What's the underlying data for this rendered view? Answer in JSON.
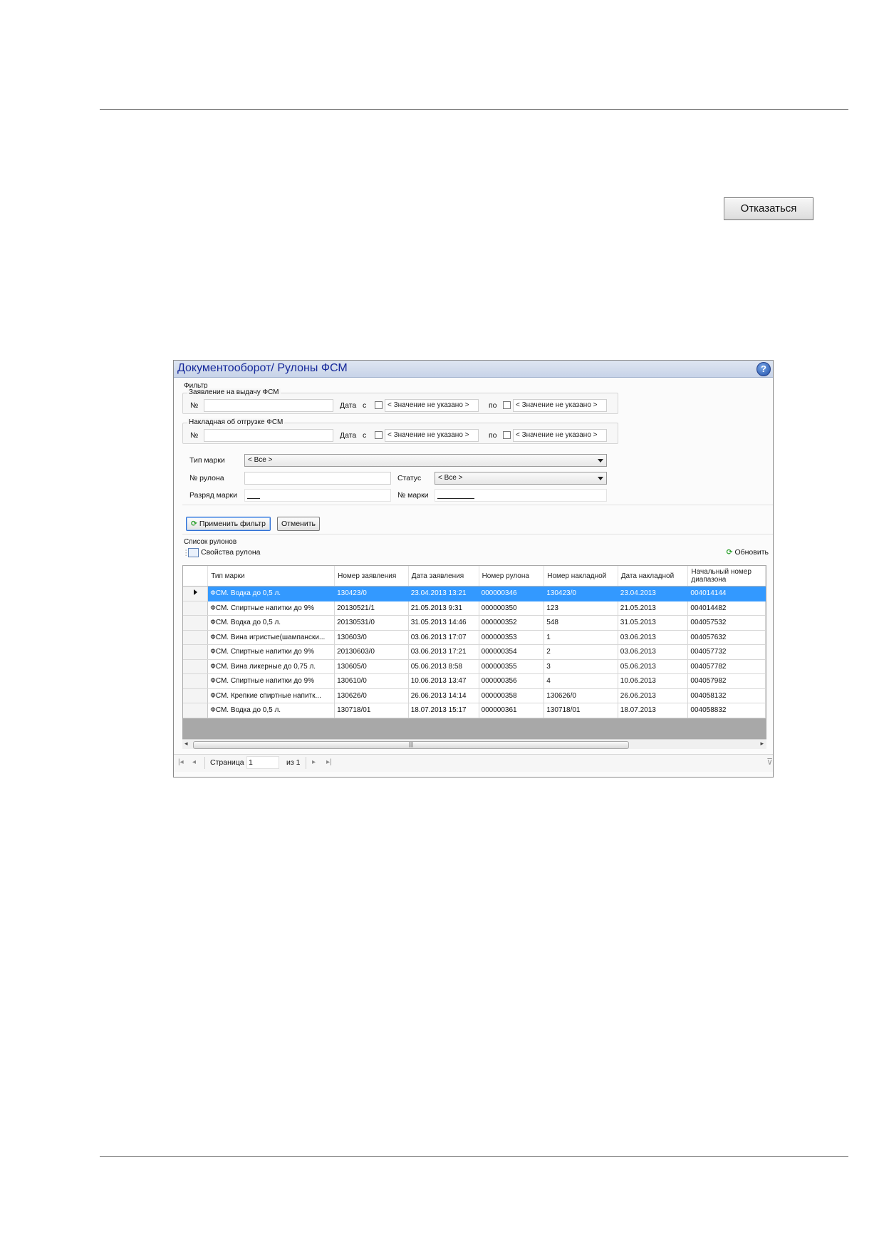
{
  "page": {
    "cancel_button": "Отказаться"
  },
  "window": {
    "title": "Документооборот/ Рулоны ФСМ",
    "help_icon": "?"
  },
  "filter": {
    "section_label": "Фильтр",
    "statement": {
      "group_label": "Заявление на выдачу ФСМ",
      "number_label": "№",
      "date_label": "Дата",
      "from_label": "с",
      "from_value": "< Значение не указано >",
      "to_label": "по",
      "to_value": "< Значение не указано >"
    },
    "invoice": {
      "group_label": "Накладная об отгрузке ФСМ",
      "number_label": "№",
      "date_label": "Дата",
      "from_label": "с",
      "from_value": "< Значение не указано >",
      "to_label": "по",
      "to_value": "< Значение не указано >"
    },
    "mark_type_label": "Тип марки",
    "mark_type_value": "< Все >",
    "roll_number_label": "№ рулона",
    "status_label": "Статус",
    "status_value": "< Все >",
    "mark_rank_label": "Разряд марки",
    "mark_number_label": "№ марки",
    "apply_button": "Применить фильтр",
    "reset_button": "Отменить"
  },
  "list": {
    "section_label": "Список рулонов",
    "properties_button": "Свойства рулона",
    "refresh_button": "Обновить",
    "columns": [
      "Тип марки",
      "Номер заявления",
      "Дата заявления",
      "Номер рулона",
      "Номер накладной",
      "Дата накладной",
      "Начальный номер диапазона"
    ],
    "rows": [
      {
        "type": "ФСМ. Водка до 0,5 л.",
        "stmt_no": "130423/0",
        "stmt_date": "23.04.2013 13:21",
        "roll_no": "000000346",
        "inv_no": "130423/0",
        "inv_date": "23.04.2013",
        "range_start": "004014144"
      },
      {
        "type": "ФСМ. Спиртные напитки до 9%",
        "stmt_no": "20130521/1",
        "stmt_date": "21.05.2013 9:31",
        "roll_no": "000000350",
        "inv_no": "123",
        "inv_date": "21.05.2013",
        "range_start": "004014482"
      },
      {
        "type": "ФСМ. Водка до 0,5 л.",
        "stmt_no": "20130531/0",
        "stmt_date": "31.05.2013 14:46",
        "roll_no": "000000352",
        "inv_no": "548",
        "inv_date": "31.05.2013",
        "range_start": "004057532"
      },
      {
        "type": "ФСМ. Вина игристые(шампански...",
        "stmt_no": "130603/0",
        "stmt_date": "03.06.2013 17:07",
        "roll_no": "000000353",
        "inv_no": "1",
        "inv_date": "03.06.2013",
        "range_start": "004057632"
      },
      {
        "type": "ФСМ. Спиртные напитки до 9%",
        "stmt_no": "20130603/0",
        "stmt_date": "03.06.2013 17:21",
        "roll_no": "000000354",
        "inv_no": "2",
        "inv_date": "03.06.2013",
        "range_start": "004057732"
      },
      {
        "type": "ФСМ. Вина ликерные до 0,75 л.",
        "stmt_no": "130605/0",
        "stmt_date": "05.06.2013 8:58",
        "roll_no": "000000355",
        "inv_no": "3",
        "inv_date": "05.06.2013",
        "range_start": "004057782"
      },
      {
        "type": "ФСМ. Спиртные напитки до 9%",
        "stmt_no": "130610/0",
        "stmt_date": "10.06.2013 13:47",
        "roll_no": "000000356",
        "inv_no": "4",
        "inv_date": "10.06.2013",
        "range_start": "004057982"
      },
      {
        "type": "ФСМ. Крепкие спиртные напитк...",
        "stmt_no": "130626/0",
        "stmt_date": "26.06.2013 14:14",
        "roll_no": "000000358",
        "inv_no": "130626/0",
        "inv_date": "26.06.2013",
        "range_start": "004058132"
      },
      {
        "type": "ФСМ. Водка до 0,5 л.",
        "stmt_no": "130718/01",
        "stmt_date": "18.07.2013 15:17",
        "roll_no": "000000361",
        "inv_no": "130718/01",
        "inv_date": "18.07.2013",
        "range_start": "004058832"
      }
    ],
    "selected_row": 0
  },
  "pager": {
    "page_label": "Страница",
    "page_value": "1",
    "of_label": "из 1"
  }
}
